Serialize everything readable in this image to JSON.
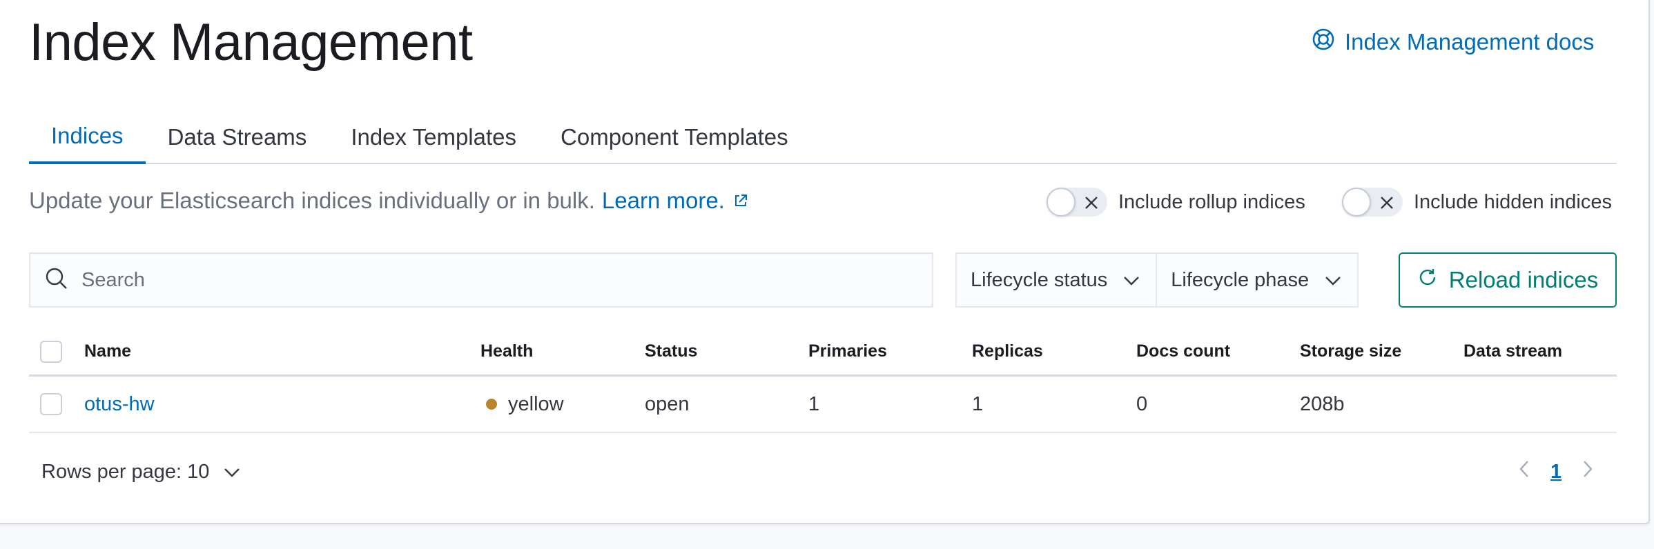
{
  "header": {
    "title": "Index Management",
    "docs_link": "Index Management docs",
    "docs_icon": "lifebuoy-icon"
  },
  "tabs": [
    {
      "label": "Indices",
      "selected": true
    },
    {
      "label": "Data Streams",
      "selected": false
    },
    {
      "label": "Index Templates",
      "selected": false
    },
    {
      "label": "Component Templates",
      "selected": false
    }
  ],
  "description": {
    "text": "Update your Elasticsearch indices individually or in bulk.",
    "link": "Learn more."
  },
  "toggles": {
    "rollup": {
      "label": "Include rollup indices",
      "on": false
    },
    "hidden": {
      "label": "Include hidden indices",
      "on": false
    }
  },
  "search": {
    "placeholder": "Search",
    "value": ""
  },
  "filters": {
    "lifecycle_status": "Lifecycle status",
    "lifecycle_phase": "Lifecycle phase"
  },
  "reload_button": "Reload indices",
  "table": {
    "columns": [
      "Name",
      "Health",
      "Status",
      "Primaries",
      "Replicas",
      "Docs count",
      "Storage size",
      "Data stream"
    ],
    "rows": [
      {
        "name": "otus-hw",
        "health": "yellow",
        "status": "open",
        "primaries": "1",
        "replicas": "1",
        "docs_count": "0",
        "storage_size": "208b",
        "data_stream": ""
      }
    ]
  },
  "pagination": {
    "rows_per_page": "Rows per page: 10",
    "current_page": "1"
  },
  "colors": {
    "accent": "#006bb8",
    "success": "#017d73",
    "health_yellow": "#b9862e"
  }
}
